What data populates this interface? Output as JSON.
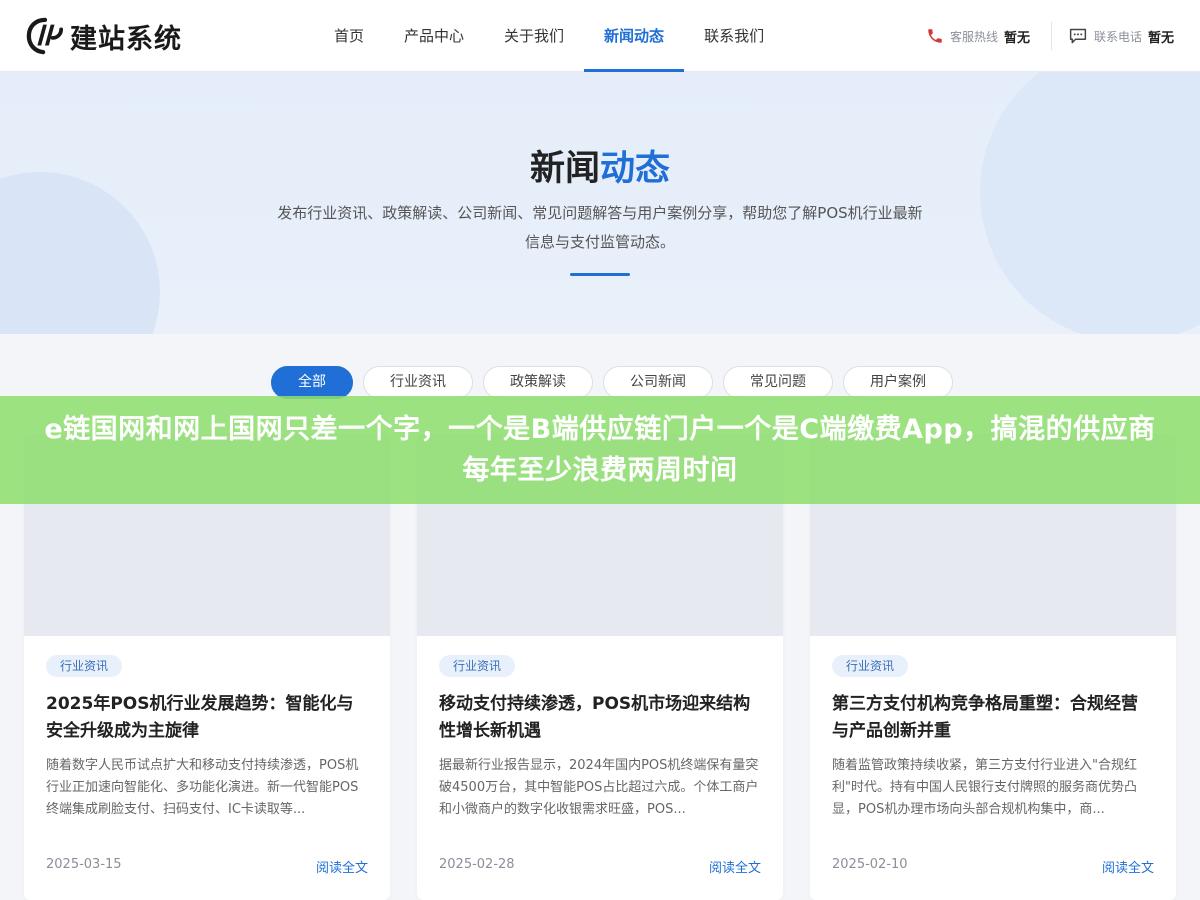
{
  "header": {
    "logo_text": "建站系统",
    "nav": [
      {
        "label": "首页"
      },
      {
        "label": "产品中心"
      },
      {
        "label": "关于我们"
      },
      {
        "label": "新闻动态",
        "active": true
      },
      {
        "label": "联系我们"
      }
    ],
    "hotline_label": "客服热线",
    "hotline_value": "暂无",
    "phone_label": "联系电话",
    "phone_value": "暂无"
  },
  "hero": {
    "title_main": "新闻",
    "title_highlight": "动态",
    "description": "发布行业资讯、政策解读、公司新闻、常见问题解答与用户案例分享，帮助您了解POS机行业最新信息与支付监管动态。"
  },
  "filters": [
    "全部",
    "行业资讯",
    "政策解读",
    "公司新闻",
    "常见问题",
    "用户案例"
  ],
  "active_filter": "全部",
  "banner": {
    "text": "e链国网和网上国网只差一个字，一个是B端供应链门户一个是C端缴费App，搞混的供应商每年至少浪费两周时间"
  },
  "cards": [
    {
      "tag": "行业资讯",
      "title": "2025年POS机行业发展趋势：智能化与安全升级成为主旋律",
      "excerpt": "随着数字人民币试点扩大和移动支付持续渗透，POS机行业正加速向智能化、多功能化演进。新一代智能POS终端集成刷脸支付、扫码支付、IC卡读取等...",
      "date": "2025-03-15",
      "more": "阅读全文"
    },
    {
      "tag": "行业资讯",
      "title": "移动支付持续渗透，POS机市场迎来结构性增长新机遇",
      "excerpt": "据最新行业报告显示，2024年国内POS机终端保有量突破4500万台，其中智能POS占比超过六成。个体工商户和小微商户的数字化收银需求旺盛，POS...",
      "date": "2025-02-28",
      "more": "阅读全文"
    },
    {
      "tag": "行业资讯",
      "title": "第三方支付机构竞争格局重塑：合规经营与产品创新并重",
      "excerpt": "随着监管政策持续收紧，第三方支付行业进入\"合规红利\"时代。持有中国人民银行支付牌照的服务商优势凸显，POS机办理市场向头部合规机构集中，商...",
      "date": "2025-02-10",
      "more": "阅读全文"
    }
  ],
  "colors": {
    "accent": "#1f6fd6",
    "banner": "#8ede6e"
  }
}
